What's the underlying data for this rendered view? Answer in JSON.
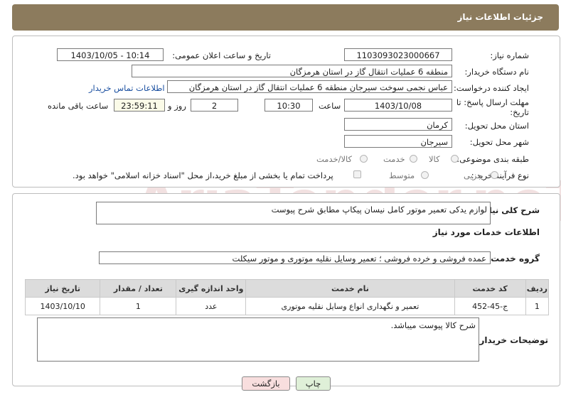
{
  "header": {
    "title": "جزئیات اطلاعات نیاز"
  },
  "form": {
    "need_number_label": "شماره نیاز:",
    "need_number": "1103093023000667",
    "announce_datetime_label": "تاریخ و ساعت اعلان عمومی:",
    "announce_datetime": "1403/10/05 - 10:14",
    "buyer_org_label": "نام دستگاه خریدار:",
    "buyer_org": "منطقه 6 عملیات انتقال گاز در استان هرمزگان",
    "requester_label": "ایجاد کننده درخواست:",
    "requester": "عباس نجمی سوخت سیرجان منطقه 6 عملیات انتقال گاز در استان هرمزگان",
    "contact_link": "اطلاعات تماس خریدار",
    "deadline_label": "مهلت ارسال پاسخ: تا تاریخ:",
    "deadline_date": "1403/10/08",
    "time_label": "ساعت",
    "deadline_time": "10:30",
    "days_value": "2",
    "days_label": "روز و",
    "remaining_time": "23:59:11",
    "remaining_label": "ساعت باقی مانده",
    "province_label": "استان محل تحویل:",
    "province": "کرمان",
    "city_label": "شهر محل تحویل:",
    "city": "سیرجان",
    "category_label": "طبقه بندی موضوعی:",
    "category_options": [
      "کالا",
      "خدمت",
      "کالا/خدمت"
    ],
    "process_label": "نوع فرآیند خرید :",
    "process_options": [
      "جزیی",
      "متوسط"
    ],
    "payment_note": "پرداخت تمام یا بخشی از مبلغ خرید،از محل \"اسناد خزانه اسلامی\" خواهد بود."
  },
  "description": {
    "label": "شرح کلی نیاز:",
    "value": "لوازم یدکی تعمیر موتور کامل نیسان پیکاپ مطابق شرح پیوست"
  },
  "services": {
    "section_title": "اطلاعات خدمات مورد نیاز",
    "group_label": "گروه خدمت:",
    "group_value": "عمده فروشی و خرده فروشی ؛ تعمیر وسایل نقلیه موتوری و موتور سیکلت",
    "table": {
      "headers": [
        "ردیف",
        "کد خدمت",
        "نام خدمت",
        "واحد اندازه گیری",
        "تعداد / مقدار",
        "تاریخ نیاز"
      ],
      "rows": [
        [
          "1",
          "ج-45-452",
          "تعمیر و نگهداری انواع وسایل نقلیه موتوری",
          "عدد",
          "1",
          "1403/10/10"
        ]
      ]
    }
  },
  "buyer_notes": {
    "label": "توضیحات خریدار:",
    "value": "شرح کالا پیوست میباشد."
  },
  "buttons": {
    "print": "چاپ",
    "back": "بازگشت"
  },
  "watermark": "AriaTender.neT"
}
